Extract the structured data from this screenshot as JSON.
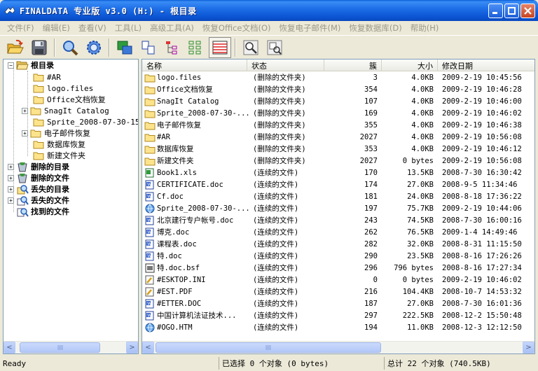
{
  "window": {
    "title": "FINALDATA 专业版 v3.0 (H:) - 根目录"
  },
  "menu": [
    "文件(F)",
    "编辑(E)",
    "查看(V)",
    "工具(L)",
    "高级工具(A)",
    "恢复Office文档(O)",
    "恢复电子邮件(M)",
    "恢复数据库(D)",
    "帮助(H)"
  ],
  "toolbar": {
    "icons": [
      "open-folder-icon",
      "save-disk-icon",
      "find-icon",
      "settings-gear-icon",
      "recover-icon",
      "copy-files-icon",
      "tree-view-icon",
      "tree-expand-icon",
      "list-view-icon",
      "zoom-icon",
      "preview-icon"
    ]
  },
  "tree": {
    "root": "根目录",
    "children": [
      "#AR",
      "logo.files",
      "Office文档恢复",
      "SnagIt Catalog",
      "Sprite_2008-07-30-15-5",
      "电子邮件恢复",
      "数据库恢复",
      "新建文件夹"
    ],
    "special": [
      "删除的目录",
      "删除的文件",
      "丢失的目录",
      "丢失的文件",
      "找到的文件"
    ]
  },
  "list": {
    "columns": [
      "名称",
      "状态",
      "簇",
      "大小",
      "修改日期"
    ],
    "rows": [
      {
        "icon": "folder",
        "name": "logo.files",
        "status": "(删除的文件夹)",
        "clusters": "3",
        "size": "4.0KB",
        "date": "2009-2-19 10:45:56"
      },
      {
        "icon": "folder",
        "name": "Office文档恢复",
        "status": "(删除的文件夹)",
        "clusters": "354",
        "size": "4.0KB",
        "date": "2009-2-19 10:46:28"
      },
      {
        "icon": "folder",
        "name": "SnagIt Catalog",
        "status": "(删除的文件夹)",
        "clusters": "107",
        "size": "4.0KB",
        "date": "2009-2-19 10:46:00"
      },
      {
        "icon": "folder",
        "name": "Sprite_2008-07-30-...",
        "status": "(删除的文件夹)",
        "clusters": "169",
        "size": "4.0KB",
        "date": "2009-2-19 10:46:02"
      },
      {
        "icon": "folder",
        "name": "电子邮件恢复",
        "status": "(删除的文件夹)",
        "clusters": "355",
        "size": "4.0KB",
        "date": "2009-2-19 10:46:38"
      },
      {
        "icon": "folder",
        "name": "#AR",
        "status": "(删除的文件夹)",
        "clusters": "2027",
        "size": "4.0KB",
        "date": "2009-2-19 10:56:08"
      },
      {
        "icon": "folder",
        "name": "数据库恢复",
        "status": "(删除的文件夹)",
        "clusters": "353",
        "size": "4.0KB",
        "date": "2009-2-19 10:46:12"
      },
      {
        "icon": "folder",
        "name": "新建文件夹",
        "status": "(删除的文件夹)",
        "clusters": "2027",
        "size": "0 bytes",
        "date": "2009-2-19 10:56:08"
      },
      {
        "icon": "xls",
        "name": "Book1.xls",
        "status": "(连续的文件)",
        "clusters": "170",
        "size": "13.5KB",
        "date": "2008-7-30 16:30:42"
      },
      {
        "icon": "doc",
        "name": "CERTIFICATE.doc",
        "status": "(连续的文件)",
        "clusters": "174",
        "size": "27.0KB",
        "date": "2008-9-5 11:34:46"
      },
      {
        "icon": "doc",
        "name": "Cf.doc",
        "status": "(连续的文件)",
        "clusters": "181",
        "size": "24.0KB",
        "date": "2008-8-18 17:36:22"
      },
      {
        "icon": "htm",
        "name": "Sprite_2008-07-30-...",
        "status": "(连续的文件)",
        "clusters": "197",
        "size": "75.7KB",
        "date": "2009-2-19 10:44:06"
      },
      {
        "icon": "doc",
        "name": "北京建行专户帐号.doc",
        "status": "(连续的文件)",
        "clusters": "243",
        "size": "74.5KB",
        "date": "2008-7-30 16:00:16"
      },
      {
        "icon": "doc",
        "name": "博克.doc",
        "status": "(连续的文件)",
        "clusters": "262",
        "size": "76.5KB",
        "date": "2009-1-4 14:49:46"
      },
      {
        "icon": "doc",
        "name": "课程表.doc",
        "status": "(连续的文件)",
        "clusters": "282",
        "size": "32.0KB",
        "date": "2008-8-31 11:15:50"
      },
      {
        "icon": "doc",
        "name": "特.doc",
        "status": "(连续的文件)",
        "clusters": "290",
        "size": "23.5KB",
        "date": "2008-8-16 17:26:26"
      },
      {
        "icon": "bsf",
        "name": "特.doc.bsf",
        "status": "(连续的文件)",
        "clusters": "296",
        "size": "796 bytes",
        "date": "2008-8-16 17:27:34"
      },
      {
        "icon": "ini",
        "name": "#ESKTOP.INI",
        "status": "(连续的文件)",
        "clusters": "0",
        "size": "0 bytes",
        "date": "2009-2-19 10:46:02"
      },
      {
        "icon": "pdf",
        "name": "#EST.PDF",
        "status": "(连续的文件)",
        "clusters": "216",
        "size": "104.4KB",
        "date": "2008-10-7 14:53:32"
      },
      {
        "icon": "doc",
        "name": "#ETTER.DOC",
        "status": "(连续的文件)",
        "clusters": "187",
        "size": "27.0KB",
        "date": "2008-7-30 16:01:36"
      },
      {
        "icon": "doc",
        "name": "中国计算机法证技术...",
        "status": "(连续的文件)",
        "clusters": "297",
        "size": "222.5KB",
        "date": "2008-12-2 15:50:48"
      },
      {
        "icon": "htm",
        "name": "#OGO.HTM",
        "status": "(连续的文件)",
        "clusters": "194",
        "size": "11.0KB",
        "date": "2008-12-3 12:12:50"
      }
    ]
  },
  "statusbar": {
    "ready": "Ready",
    "selected": "已选择 0 个对象 (0 bytes)",
    "total": "总计 22 个对象 (740.5KB)"
  }
}
